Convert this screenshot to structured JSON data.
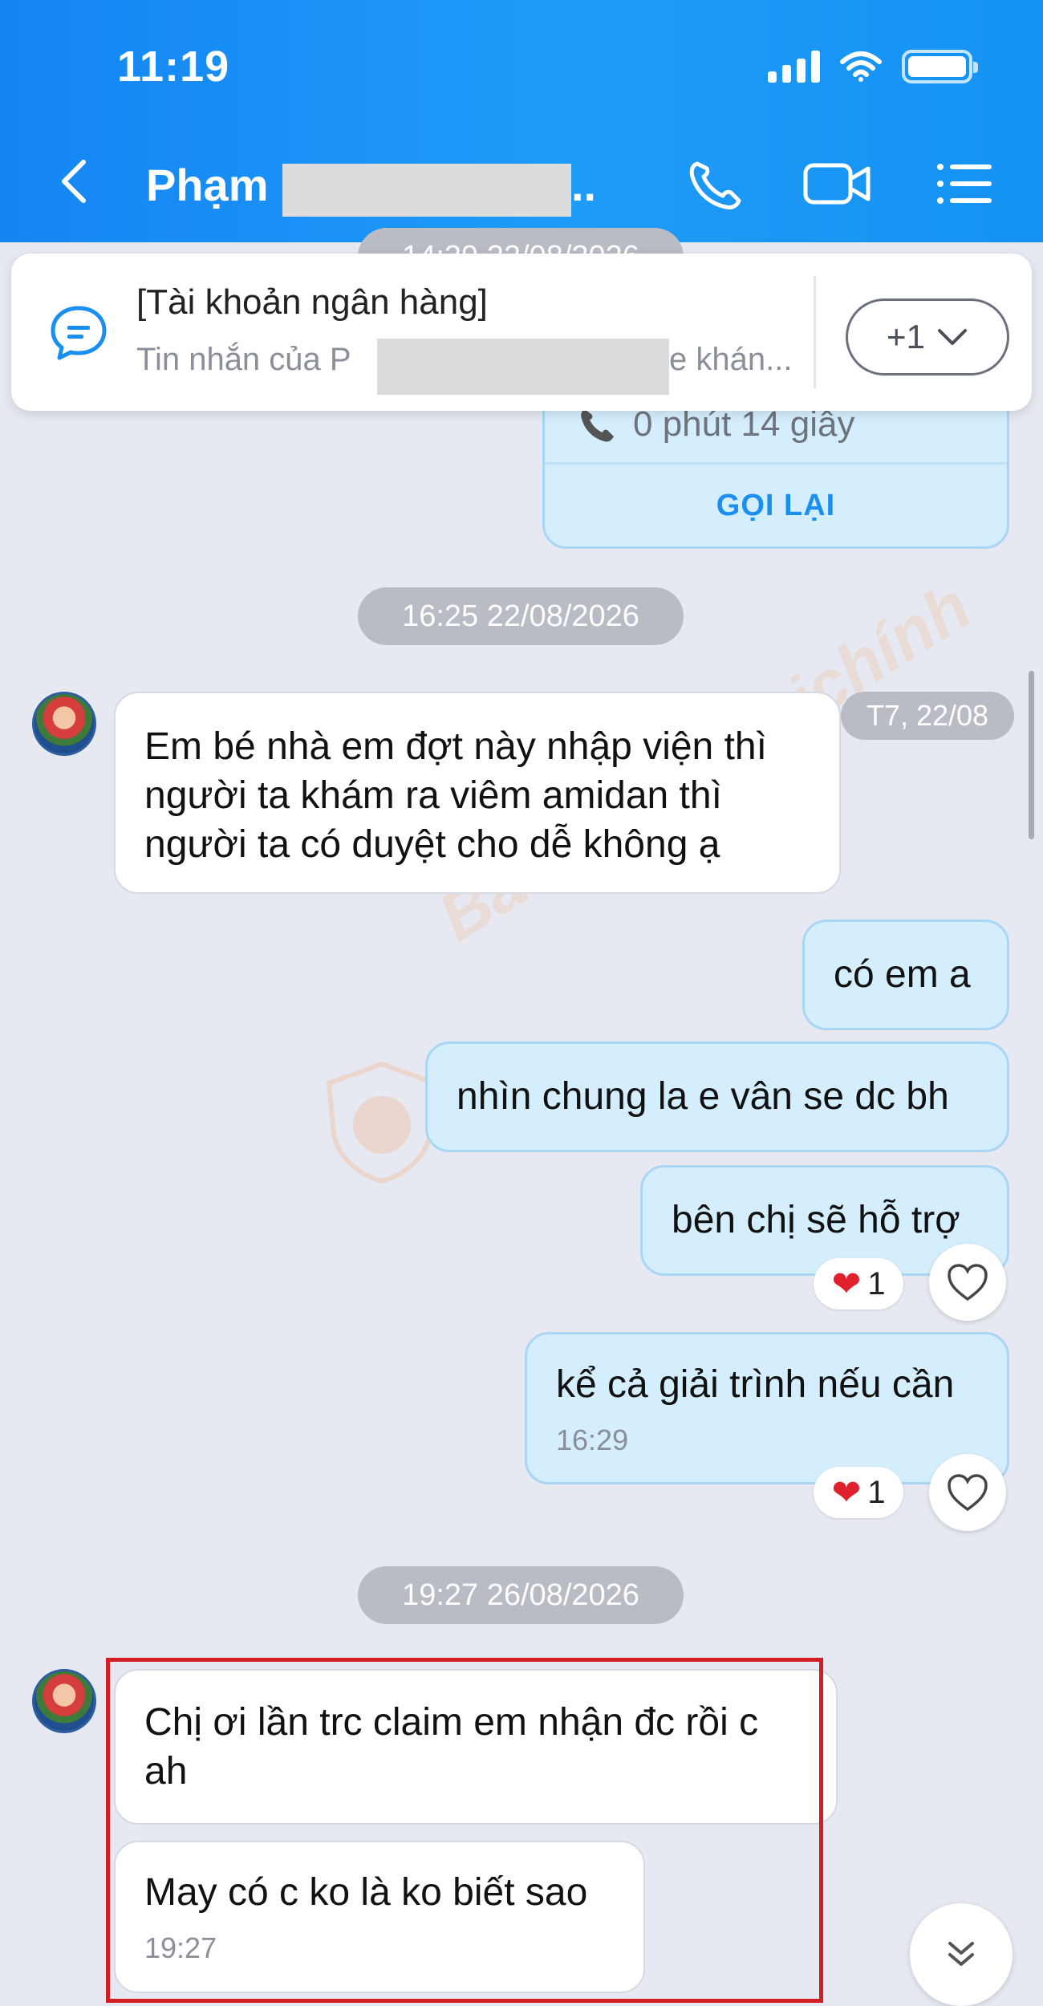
{
  "status_bar": {
    "time": "11:19"
  },
  "header": {
    "contact_name": "Phạm",
    "name_ellipsis": "..",
    "colors": {
      "background": "#1a8ff3",
      "text": "#ffffff"
    }
  },
  "pinned_banner": {
    "title": "[Tài khoản ngân hàng]",
    "subtitle_prefix": "Tin nhắn của P",
    "subtitle_suffix": "e khán...",
    "more_count": "+1",
    "icon": "chat-bubble-icon"
  },
  "messages": {
    "partial_time": "14:39 22/08/2026",
    "call_card": {
      "duration": "0 phút 14 giây",
      "callback_label": "GỌI LẠI"
    },
    "time_sep_1": "16:25 22/08/2026",
    "date_tag": "T7, 22/08",
    "in_msg_1": {
      "line1": "Em bé nhà em đợt này nhập viện thì",
      "line2": "người ta khám ra viêm amidan thì",
      "line3": "người ta có duyệt cho dễ không ạ"
    },
    "out_msg_1": "có em a",
    "out_msg_2": "nhìn chung la e vân se dc bh",
    "out_msg_3": "bên chị sẽ hỗ trợ",
    "reaction_1": {
      "count": "1"
    },
    "out_msg_4": {
      "text": "kể cả giải trình nếu cần",
      "time": "16:29"
    },
    "reaction_2": {
      "count": "1"
    },
    "time_sep_2": "19:27 26/08/2026",
    "in_msg_2": {
      "line1": "Chị ơi lần trc claim em nhận đc rồi c",
      "line2": "ah"
    },
    "in_msg_3": {
      "text": "May có c ko là ko biết sao",
      "time": "19:27"
    }
  },
  "watermark": "Bảohiểm&Tàichính",
  "colors": {
    "out_bubble": "#d4eefe",
    "accent": "#1a8ff0",
    "highlight": "#d31c23"
  }
}
